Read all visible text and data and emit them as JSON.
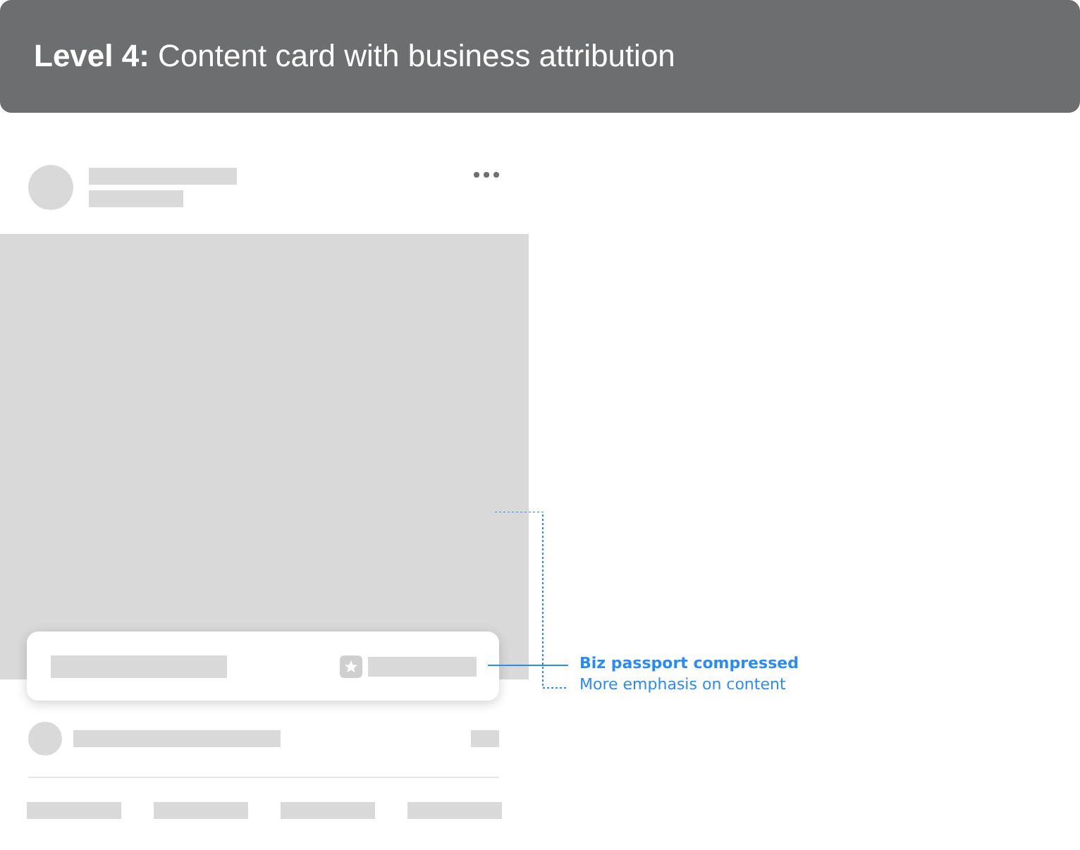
{
  "header": {
    "title": "**Level 4:** Content card with business attribution"
  },
  "annotation": {
    "title": "Biz passport compressed",
    "note": "More emphasis on content"
  }
}
